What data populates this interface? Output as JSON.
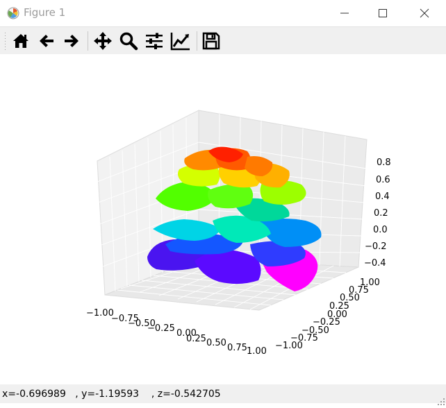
{
  "window": {
    "title": "Figure 1"
  },
  "toolbar": {
    "tools": [
      "home-icon",
      "back-arrow-icon",
      "forward-arrow-icon",
      "pan-icon",
      "zoom-icon",
      "configure-subplots-icon",
      "edit-axis-icon",
      "save-icon"
    ]
  },
  "axes": {
    "x_ticks": [
      "−1.00",
      "−0.75",
      "−0.50",
      "−0.25",
      "0.00",
      "0.25",
      "0.50",
      "0.75",
      "1.00"
    ],
    "y_ticks": [
      "−1.00",
      "−0.75",
      "−0.50",
      "−0.25",
      "0.00",
      "0.25",
      "0.50",
      "0.75",
      "1.00"
    ],
    "z_ticks": [
      "−0.4",
      "−0.2",
      "0.0",
      "0.2",
      "0.4",
      "0.6",
      "0.8"
    ]
  },
  "status": {
    "text": "x=-0.696989   , y=-1.19593    , z=-0.542705"
  },
  "colors": {
    "surface_colormap": "gist_rainbow"
  }
}
